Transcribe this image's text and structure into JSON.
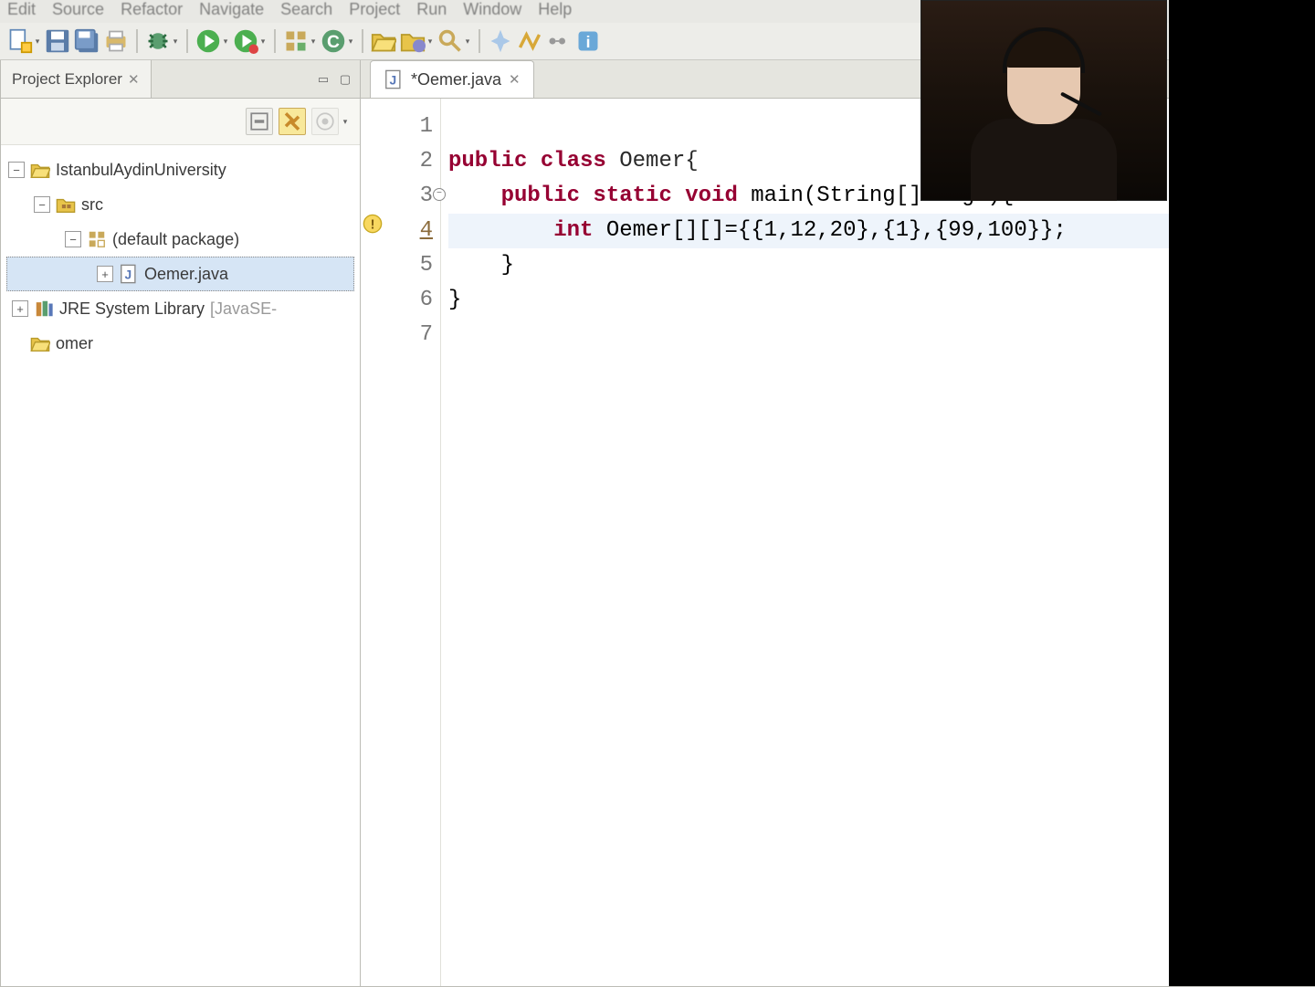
{
  "menu": {
    "items": [
      "Edit",
      "Source",
      "Refactor",
      "Navigate",
      "Search",
      "Project",
      "Run",
      "Window",
      "Help"
    ]
  },
  "sidebar": {
    "title": "Project Explorer",
    "tree": {
      "proj1": "IstanbulAydinUniversity",
      "src": "src",
      "pkg": "(default package)",
      "file": "Oemer.java",
      "jre": "JRE System Library",
      "jre_suffix": "[JavaSE-",
      "proj2": "omer"
    }
  },
  "editor": {
    "tab": "*Oemer.java",
    "lines": {
      "1": "",
      "2_kw1": "public class",
      "2_cls": " Oemer{",
      "3_kw1": "public static void",
      "3_rest": " main(String[] args){",
      "4_kw1": "int",
      "4_rest": " Oemer[][]={{1,12,20},{1},{99,100}};",
      "5": "}",
      "6": "}",
      "7": ""
    },
    "line_numbers": [
      "1",
      "2",
      "3",
      "4",
      "5",
      "6",
      "7"
    ]
  }
}
